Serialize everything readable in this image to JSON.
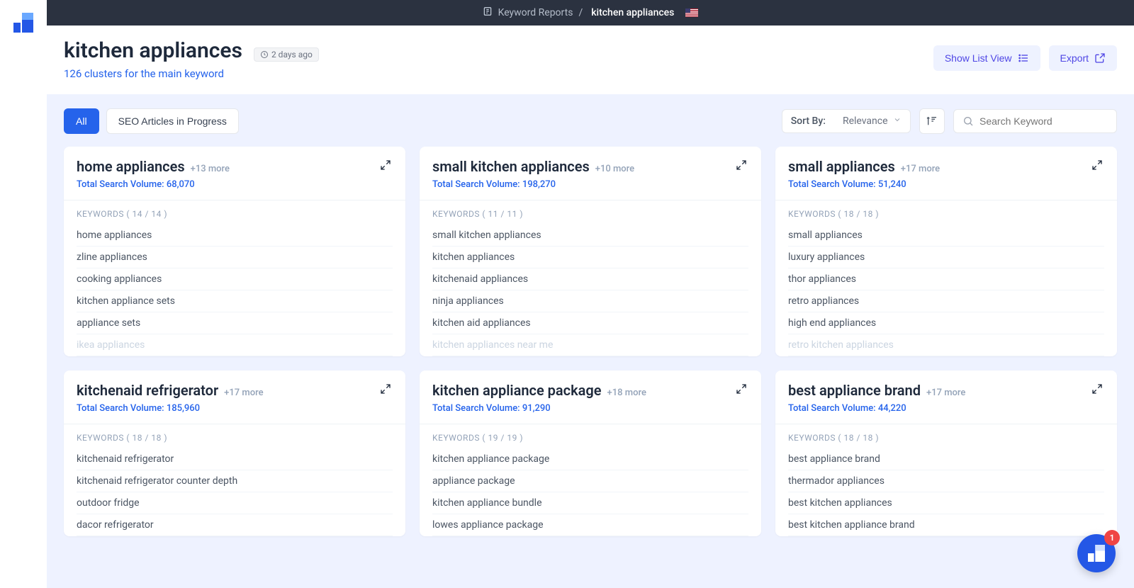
{
  "breadcrumb": {
    "section": "Keyword Reports",
    "current": "kitchen appliances"
  },
  "page": {
    "title": "kitchen appliances",
    "time_ago": "2 days ago",
    "clusters_line": "126 clusters for the main keyword"
  },
  "actions": {
    "show_list": "Show List View",
    "export": "Export"
  },
  "filters": {
    "all": "All",
    "seo": "SEO Articles in Progress",
    "sort_by_label": "Sort By:",
    "sort_value": "Relevance",
    "search_placeholder": "Search Keyword"
  },
  "labels": {
    "keywords": "KEYWORDS",
    "volume_prefix": "Total Search Volume: "
  },
  "cards": [
    {
      "title": "home appliances",
      "more": "+13 more",
      "volume": "68,070",
      "count_shown": 14,
      "count_total": 14,
      "keywords": [
        "home appliances",
        "zline appliances",
        "cooking appliances",
        "kitchen appliance sets",
        "appliance sets",
        "ikea appliances"
      ]
    },
    {
      "title": "small kitchen appliances",
      "more": "+10 more",
      "volume": "198,270",
      "count_shown": 11,
      "count_total": 11,
      "keywords": [
        "small kitchen appliances",
        "kitchen appliances",
        "kitchenaid appliances",
        "ninja appliances",
        "kitchen aid appliances",
        "kitchen appliances near me"
      ]
    },
    {
      "title": "small appliances",
      "more": "+17 more",
      "volume": "51,240",
      "count_shown": 18,
      "count_total": 18,
      "keywords": [
        "small appliances",
        "luxury appliances",
        "thor appliances",
        "retro appliances",
        "high end appliances",
        "retro kitchen appliances"
      ]
    },
    {
      "title": "kitchenaid refrigerator",
      "more": "+17 more",
      "volume": "185,960",
      "count_shown": 18,
      "count_total": 18,
      "keywords": [
        "kitchenaid refrigerator",
        "kitchenaid refrigerator counter depth",
        "outdoor fridge",
        "dacor refrigerator"
      ]
    },
    {
      "title": "kitchen appliance package",
      "more": "+18 more",
      "volume": "91,290",
      "count_shown": 19,
      "count_total": 19,
      "keywords": [
        "kitchen appliance package",
        "appliance package",
        "kitchen appliance bundle",
        "lowes appliance package"
      ]
    },
    {
      "title": "best appliance brand",
      "more": "+17 more",
      "volume": "44,220",
      "count_shown": 18,
      "count_total": 18,
      "keywords": [
        "best appliance brand",
        "thermador appliances",
        "best kitchen appliances",
        "best kitchen appliance brand"
      ]
    }
  ],
  "fab": {
    "badge": "1"
  }
}
